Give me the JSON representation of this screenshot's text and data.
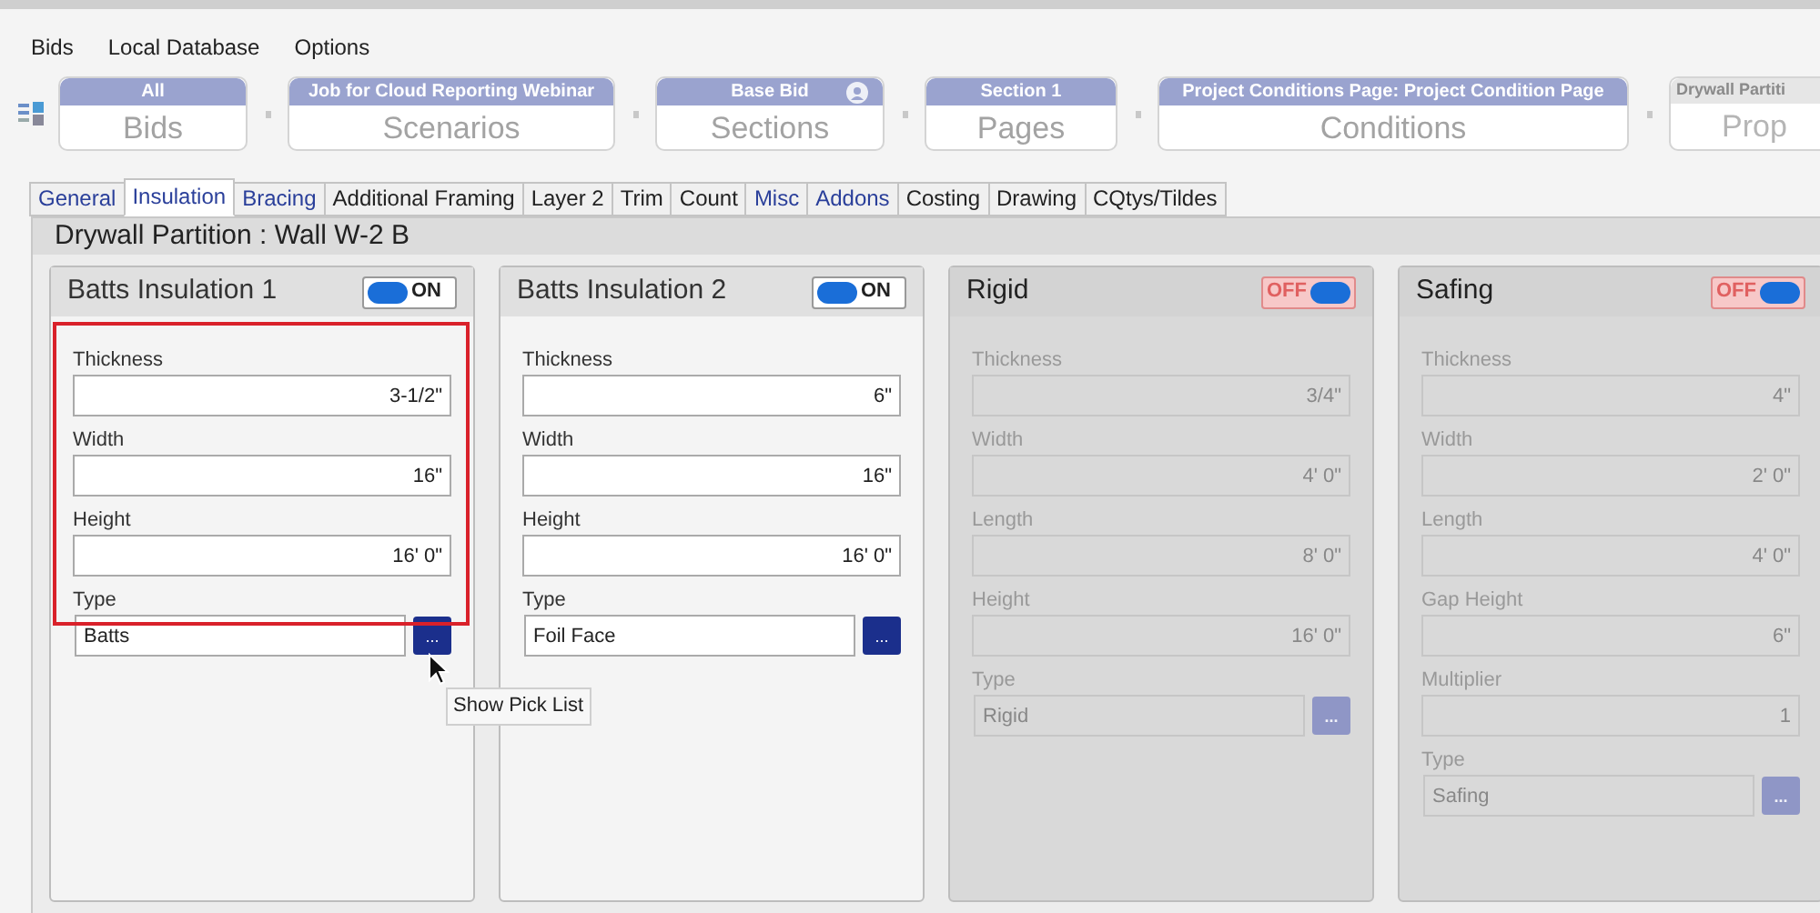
{
  "menu": [
    "Bids",
    "Local Database",
    "Options"
  ],
  "breadcrumb": [
    {
      "caption": "All",
      "label": "Bids",
      "disabled": false,
      "badge": false
    },
    {
      "caption": "Job for Cloud Reporting Webinar",
      "label": "Scenarios",
      "disabled": false,
      "badge": false
    },
    {
      "caption": "Base Bid",
      "label": "Sections",
      "disabled": false,
      "badge": true
    },
    {
      "caption": "Section 1",
      "label": "Pages",
      "disabled": false,
      "badge": false
    },
    {
      "caption": "Project Conditions Page: Project Condition Page",
      "label": "Conditions",
      "disabled": false,
      "badge": false
    },
    {
      "caption": "Drywall Partiti",
      "label": "Prop",
      "disabled": true,
      "badge": false
    }
  ],
  "tabs": [
    {
      "label": "General",
      "selected": false,
      "color": "#2a3f9a"
    },
    {
      "label": "Insulation",
      "selected": true,
      "color": "#2a3f9a"
    },
    {
      "label": "Bracing",
      "selected": false,
      "color": "#2a3f9a"
    },
    {
      "label": "Additional Framing",
      "selected": false,
      "color": "#222222"
    },
    {
      "label": "Layer 2",
      "selected": false,
      "color": "#222222"
    },
    {
      "label": "Trim",
      "selected": false,
      "color": "#222222"
    },
    {
      "label": "Count",
      "selected": false,
      "color": "#222222"
    },
    {
      "label": "Misc",
      "selected": false,
      "color": "#2a3f9a"
    },
    {
      "label": "Addons",
      "selected": false,
      "color": "#2a3f9a"
    },
    {
      "label": "Costing",
      "selected": false,
      "color": "#222222"
    },
    {
      "label": "Drawing",
      "selected": false,
      "color": "#222222"
    },
    {
      "label": "CQtys/Tildes",
      "selected": false,
      "color": "#222222"
    }
  ],
  "panel_title": "Drywall Partition : Wall W-2 B",
  "cards": [
    {
      "title": "Batts Insulation 1",
      "toggle": {
        "label": "ON",
        "on": true
      },
      "highlighted": true,
      "fields": [
        {
          "kind": "number",
          "label": "Thickness",
          "value": "3-1/2\""
        },
        {
          "kind": "number",
          "label": "Width",
          "value": "16\""
        },
        {
          "kind": "number",
          "label": "Height",
          "value": "16' 0\""
        },
        {
          "kind": "picklist",
          "label": "Type",
          "value": "Batts",
          "button": "...",
          "tooltip": "Show Pick List"
        }
      ]
    },
    {
      "title": "Batts Insulation 2",
      "toggle": {
        "label": "ON",
        "on": true
      },
      "highlighted": false,
      "fields": [
        {
          "kind": "number",
          "label": "Thickness",
          "value": "6\""
        },
        {
          "kind": "number",
          "label": "Width",
          "value": "16\""
        },
        {
          "kind": "number",
          "label": "Height",
          "value": "16' 0\""
        },
        {
          "kind": "picklist",
          "label": "Type",
          "value": "Foil Face",
          "button": "..."
        }
      ]
    },
    {
      "title": "Rigid",
      "toggle": {
        "label": "OFF",
        "on": false
      },
      "highlighted": false,
      "fields": [
        {
          "kind": "number",
          "label": "Thickness",
          "value": "3/4\""
        },
        {
          "kind": "number",
          "label": "Width",
          "value": "4' 0\""
        },
        {
          "kind": "number",
          "label": "Length",
          "value": "8' 0\""
        },
        {
          "kind": "number",
          "label": "Height",
          "value": "16' 0\""
        },
        {
          "kind": "picklist",
          "label": "Type",
          "value": "Rigid",
          "button": "..."
        }
      ]
    },
    {
      "title": "Safing",
      "toggle": {
        "label": "OFF",
        "on": false
      },
      "highlighted": false,
      "fields": [
        {
          "kind": "number",
          "label": "Thickness",
          "value": "4\""
        },
        {
          "kind": "number",
          "label": "Width",
          "value": "2' 0\""
        },
        {
          "kind": "number",
          "label": "Length",
          "value": "4' 0\""
        },
        {
          "kind": "number",
          "label": "Gap Height",
          "value": "6\""
        },
        {
          "kind": "number",
          "label": "Multiplier",
          "value": "1"
        },
        {
          "kind": "picklist",
          "label": "Type",
          "value": "Safing",
          "button": "..."
        }
      ]
    }
  ]
}
